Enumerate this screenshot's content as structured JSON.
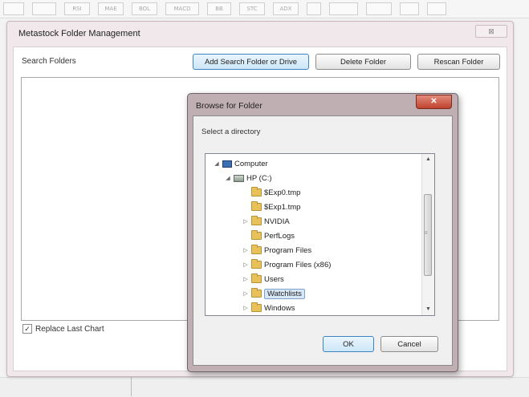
{
  "toolbar": {
    "buttons": [
      "",
      "",
      "RSI",
      "MAE",
      "BOL",
      "MACD",
      "BB",
      "STC",
      "ADX",
      "",
      "",
      "",
      "",
      ""
    ]
  },
  "main_dialog": {
    "title": "Metastock Folder Management",
    "close_label": "⊠",
    "search_folders_label": "Search Folders",
    "add_button": "Add Search Folder or Drive",
    "delete_button": "Delete Folder",
    "rescan_button": "Rescan Folder",
    "replace_last_chart": {
      "label": "Replace Last Chart",
      "checked": true
    }
  },
  "browse_dialog": {
    "title": "Browse for Folder",
    "close_label": "✕",
    "instruction": "Select a directory",
    "tree": [
      {
        "label": "Computer",
        "level": 0,
        "expander": "◢",
        "icon": "computer-icon"
      },
      {
        "label": "HP (C:)",
        "level": 1,
        "expander": "◢",
        "icon": "drive-icon"
      },
      {
        "label": "$Exp0.tmp",
        "level": 2,
        "expander": "",
        "icon": "folder-icon"
      },
      {
        "label": "$Exp1.tmp",
        "level": 2,
        "expander": "",
        "icon": "folder-icon"
      },
      {
        "label": "NVIDIA",
        "level": 2,
        "expander": "▷",
        "icon": "folder-icon"
      },
      {
        "label": "PerfLogs",
        "level": 2,
        "expander": "",
        "icon": "folder-icon"
      },
      {
        "label": "Program Files",
        "level": 2,
        "expander": "▷",
        "icon": "folder-icon"
      },
      {
        "label": "Program Files (x86)",
        "level": 2,
        "expander": "▷",
        "icon": "folder-icon"
      },
      {
        "label": "Users",
        "level": 2,
        "expander": "▷",
        "icon": "folder-icon"
      },
      {
        "label": "Watchlists",
        "level": 2,
        "expander": "▷",
        "icon": "folder-icon",
        "selected": true
      },
      {
        "label": "Windows",
        "level": 2,
        "expander": "▷",
        "icon": "folder-icon"
      }
    ],
    "ok_button": "OK",
    "cancel_button": "Cancel"
  }
}
